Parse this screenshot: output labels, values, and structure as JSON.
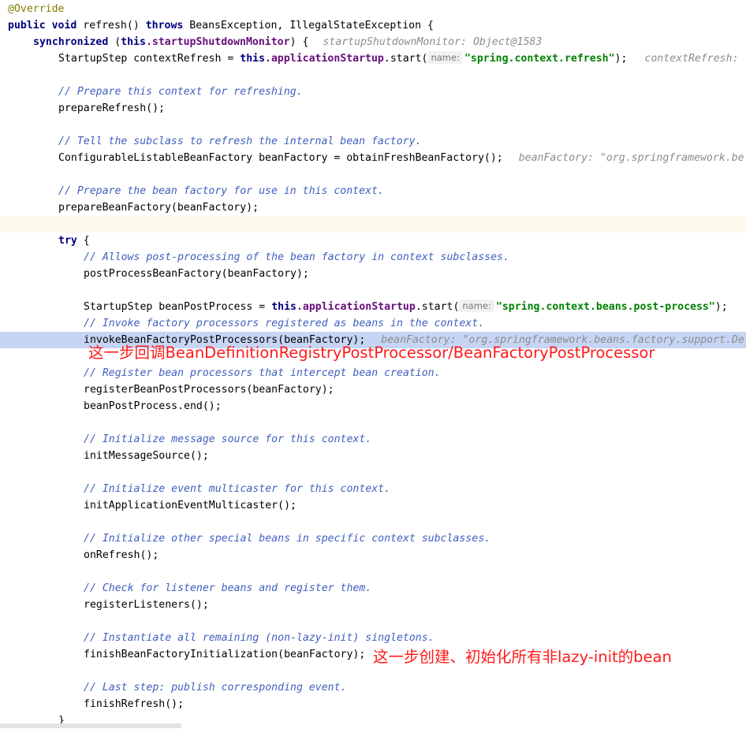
{
  "code": {
    "override": "@Override",
    "kw_public": "public",
    "kw_void": "void",
    "refresh_sig": " refresh() ",
    "kw_throws": "throws",
    "exceptions": " BeansException, IllegalStateException {",
    "kw_synchronized": "synchronized",
    "paren_open_sp": " (",
    "kw_this": "this",
    "startup_monitor_field": ".startupShutdownMonitor",
    "sync_close": ") {",
    "hint_monitor": "startupShutdownMonitor: Object@1583",
    "startup_step_decl": "StartupStep contextRefresh = ",
    "application_startup_field": ".applicationStartup",
    "start_call": ".start(",
    "param_name": "name:",
    "str_context_refresh": "\"spring.context.refresh\"",
    "call_end": ");",
    "hint_context_refresh": "contextRefresh:",
    "comment_prepare": "// Prepare this context for refreshing.",
    "prepare_refresh": "prepareRefresh();",
    "comment_tell_subclass": "// Tell the subclass to refresh the internal bean factory.",
    "obtain_factory": "ConfigurableListableBeanFactory beanFactory = obtainFreshBeanFactory();",
    "hint_bean_factory_1": "beanFactory: \"org.springframework.be",
    "comment_prepare_factory": "// Prepare the bean factory for use in this context.",
    "prepare_bean_factory": "prepareBeanFactory(beanFactory);",
    "kw_try": "try",
    "try_open": " {",
    "comment_allows_post": "// Allows post-processing of the bean factory in context subclasses.",
    "post_process_bean_factory": "postProcessBeanFactory(beanFactory);",
    "bean_post_process_decl": "StartupStep beanPostProcess = ",
    "str_post_process": "\"spring.context.beans.post-process\"",
    "comment_invoke": "// Invoke factory processors registered as beans in the context.",
    "invoke_processors": "invokeBeanFactoryPostProcessors(beanFactory);",
    "hint_bean_factory_2": "beanFactory: \"org.springframework.beans.factory.support.De",
    "comment_register": "// Register bean processors that intercept bean creation.",
    "register_processors": "registerBeanPostProcessors(beanFactory);",
    "bean_post_process_end": "beanPostProcess.end();",
    "comment_message_source": "// Initialize message source for this context.",
    "init_message_source": "initMessageSource();",
    "comment_multicaster": "// Initialize event multicaster for this context.",
    "init_multicaster": "initApplicationEventMulticaster();",
    "comment_special_beans": "// Initialize other special beans in specific context subclasses.",
    "on_refresh": "onRefresh();",
    "comment_listeners": "// Check for listener beans and register them.",
    "register_listeners": "registerListeners();",
    "comment_singletons": "// Instantiate all remaining (non-lazy-init) singletons.",
    "finish_initialization": "finishBeanFactoryInitialization(beanFactory);",
    "comment_last_step": "// Last step: publish corresponding event.",
    "finish_refresh": "finishRefresh();",
    "closing_brace": "}"
  },
  "annotations": {
    "invoke_note": "这一步回调BeanDefinitionRegistryPostProcessor/BeanFactoryPostProcessor",
    "finish_note": "这一步创建、初始化所有非lazy-init的bean"
  },
  "colors": {
    "keyword": "#000080",
    "comment": "#3f5fbf",
    "string": "#008000",
    "field": "#660e7a",
    "annotation": "#808000",
    "execution_line": "#c5d5f3",
    "caret_line": "#fefaec",
    "note": "#ff1a1a"
  }
}
